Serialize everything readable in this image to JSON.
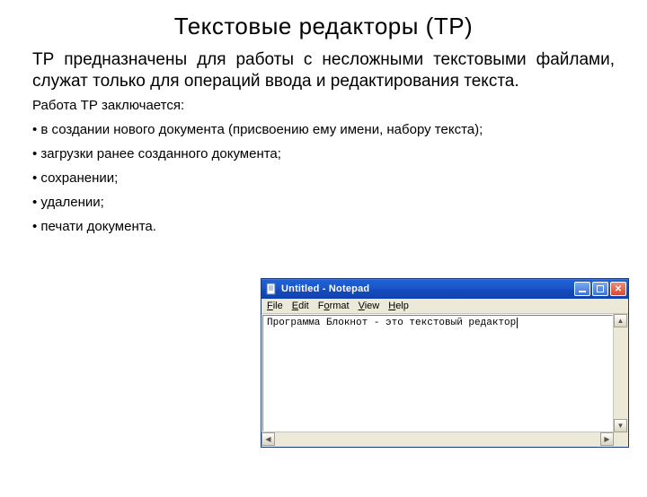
{
  "title": "Текстовые редакторы (ТР)",
  "intro": "ТР предназначены для работы с несложными текстовыми файлами, служат только для операций ввода и редактирования текста.",
  "sub": "Работа ТР заключается:",
  "bullets": [
    "• в создании нового документа (присвоению ему имени, набору текста);",
    "• загрузки ранее созданного документа;",
    "• сохранении;",
    "• удалении;",
    "• печати документа."
  ],
  "notepad": {
    "title": "Untitled - Notepad",
    "menu": {
      "file": "File",
      "edit": "Edit",
      "format": "Format",
      "view": "View",
      "help": "Help"
    },
    "content": "Программа Блокнот - это текстовый редактор"
  }
}
